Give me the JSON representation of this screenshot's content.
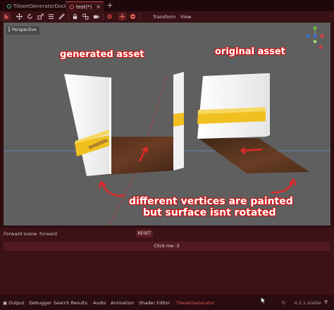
{
  "tabs": [
    {
      "label": "TilesetGeneratorDock",
      "icon": "scene-icon"
    },
    {
      "label": "test(*)",
      "icon": "scene-icon"
    }
  ],
  "tab_close_glyph": "×",
  "tab_add_glyph": "+",
  "toolbar": {
    "menus": [
      "Transform",
      "View"
    ],
    "icons": [
      "select-icon",
      "move-icon",
      "rotate-icon",
      "scale-icon",
      "list-select-icon",
      "ruler-icon",
      "lock-icon",
      "group-icon",
      "camera-icon",
      "snap-icon",
      "local-space-icon"
    ]
  },
  "viewport": {
    "mode_label": "Perspective",
    "annotations": {
      "generated": "generated asset",
      "original": "original asset",
      "note_line1": "different vertices are painted",
      "note_line2": "but surface isnt rotated"
    },
    "background_color": "#5f5f5f",
    "annotation_color": "#e02a2a"
  },
  "panel": {
    "forward_label": "Forward scene",
    "forward_value": "forward",
    "reset_label": "RESET",
    "click_label": "Click me :3"
  },
  "bottom_bar": {
    "items": [
      "Output",
      "Debugger",
      "Search Results",
      "Audio",
      "Animation",
      "Shader Editor",
      "TilesetGenerator"
    ],
    "active_item": "TilesetGenerator",
    "version": "4.2.1.stable"
  },
  "colors": {
    "accent": "#e0615a",
    "editor_bg": "#2e0d11",
    "toolbar_bg": "#3a1216"
  }
}
